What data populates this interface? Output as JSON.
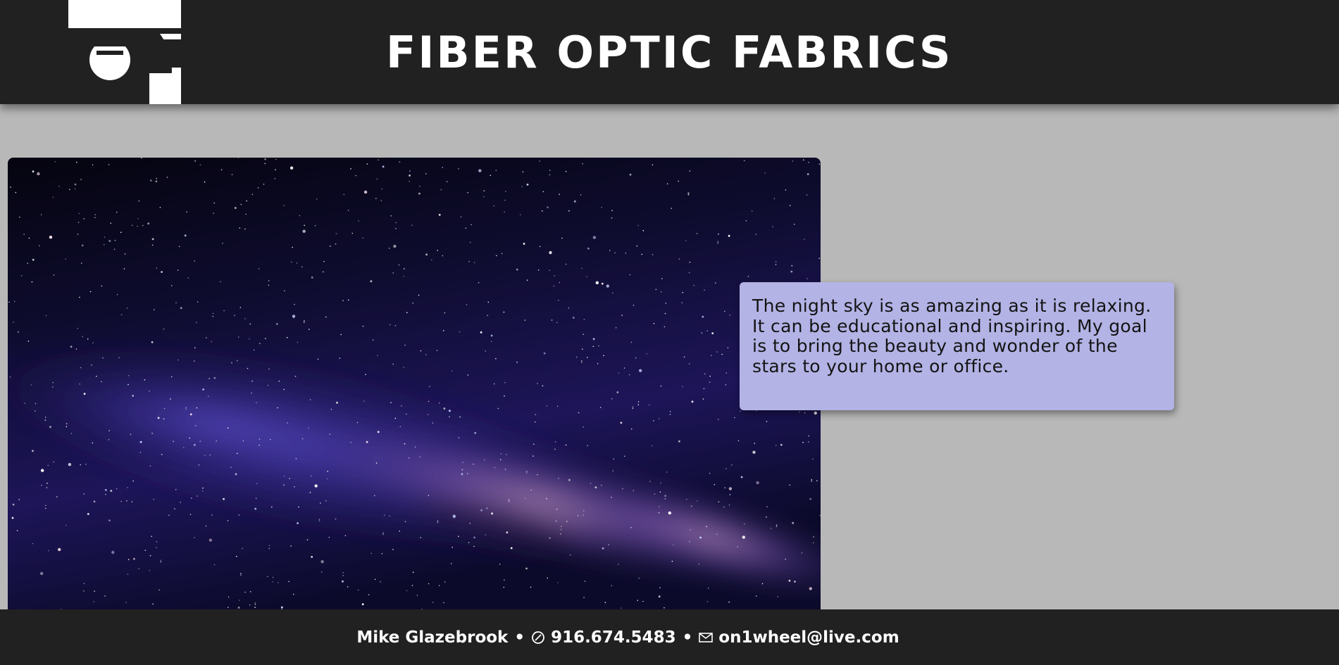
{
  "header": {
    "logo_name": "fiber-optic-fabrics-logo",
    "title": "FIBER OPTIC FABRICS",
    "background": "#212121"
  },
  "hero": {
    "image": "milky-way-night-sky"
  },
  "info_card": {
    "text": "The night sky is as amazing as it is relaxing. It can be educational and inspiring. My goal is to bring the beauty and wonder of the stars to your home or office.",
    "background": "#b3b3e6"
  },
  "footer": {
    "name": "Mike Glazebrook",
    "separator": "•",
    "phone_icon": "phone-icon",
    "phone": "916.674.5483",
    "email_icon": "mail-icon",
    "email": "on1wheel@live.com",
    "background": "#212121"
  },
  "colors": {
    "page_background": "#b8b8b8",
    "text_light": "#ffffff"
  }
}
